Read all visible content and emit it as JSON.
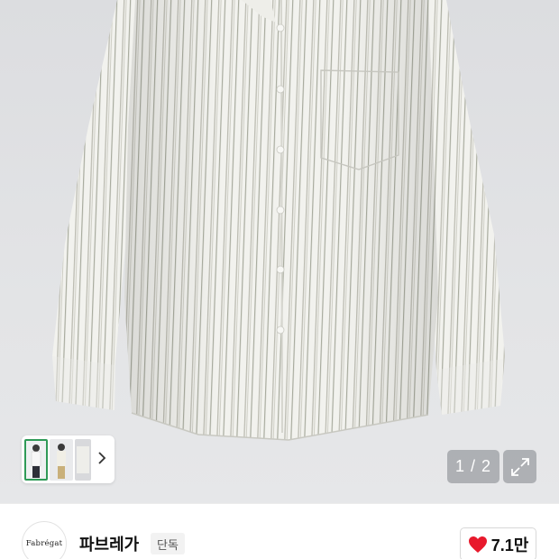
{
  "gallery": {
    "current_page": "1",
    "separator": "/",
    "total_pages": "2",
    "counter_text": "1 / 2",
    "thumbnail_next_icon": "chevron-right-icon",
    "expand_icon": "expand-arrows-icon"
  },
  "brand": {
    "logo_text": "Fabrégat",
    "name": "파브레가",
    "badge": "단독"
  },
  "like": {
    "icon": "heart-icon",
    "count": "7.1만",
    "color": "#e8192c"
  },
  "colors": {
    "thumb_selected_border": "#2f9a57",
    "image_background": "#dcdde0"
  }
}
